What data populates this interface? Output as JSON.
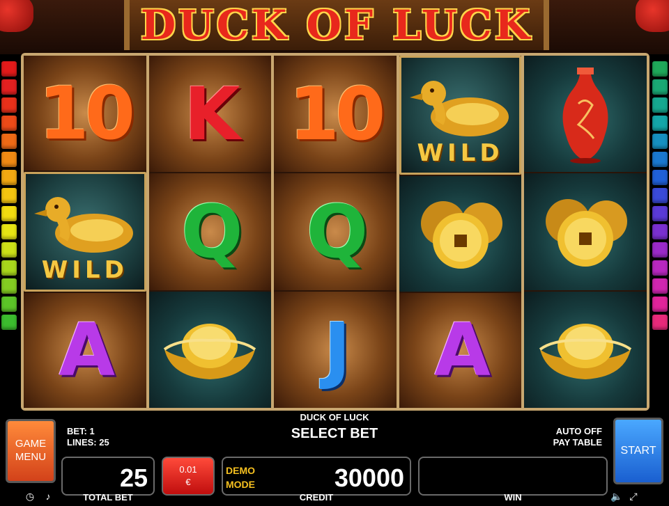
{
  "header": {
    "title": "DUCK OF LUCK"
  },
  "reels": [
    [
      "10",
      "WILD",
      "A"
    ],
    [
      "K",
      "Q",
      "gold-ingot"
    ],
    [
      "10",
      "Q",
      "J"
    ],
    [
      "WILD",
      "coins",
      "A"
    ],
    [
      "vase",
      "coins",
      "gold-ingot"
    ]
  ],
  "wild_label": "WILD",
  "panel": {
    "bet_text": "BET: 1",
    "lines_text": "LINES: 25",
    "game_name": "DUCK OF LUCK",
    "status": "SELECT BET",
    "auto_text": "AUTO OFF",
    "paytable_text": "PAY TABLE",
    "menu_label": "GAME MENU",
    "start_label": "START",
    "total_bet_value": "25",
    "total_bet_label": "TOTAL BET",
    "coin_value": "0.01",
    "currency": "€",
    "demo_line1": "DEMO",
    "demo_line2": "MODE",
    "credit_value": "30000",
    "credit_label": "CREDIT",
    "win_value": "",
    "win_label": "WIN"
  },
  "indicator_colors_left": [
    "#e21a1a",
    "#e32020",
    "#e8301a",
    "#ec4a18",
    "#ee6a16",
    "#f08a14",
    "#f2a812",
    "#f4c410",
    "#f2dc10",
    "#e6e414",
    "#cce018",
    "#a8d61c",
    "#84cc22",
    "#5cc428",
    "#3cbc2e"
  ],
  "indicator_colors_right": [
    "#1fa85a",
    "#1aa874",
    "#16a890",
    "#14a6a8",
    "#1690c0",
    "#1a78d0",
    "#2060d8",
    "#3a4ad8",
    "#5a3ad6",
    "#7a30d0",
    "#9a2ac8",
    "#b828c0",
    "#d026b0",
    "#e0249a",
    "#e82a7a"
  ]
}
